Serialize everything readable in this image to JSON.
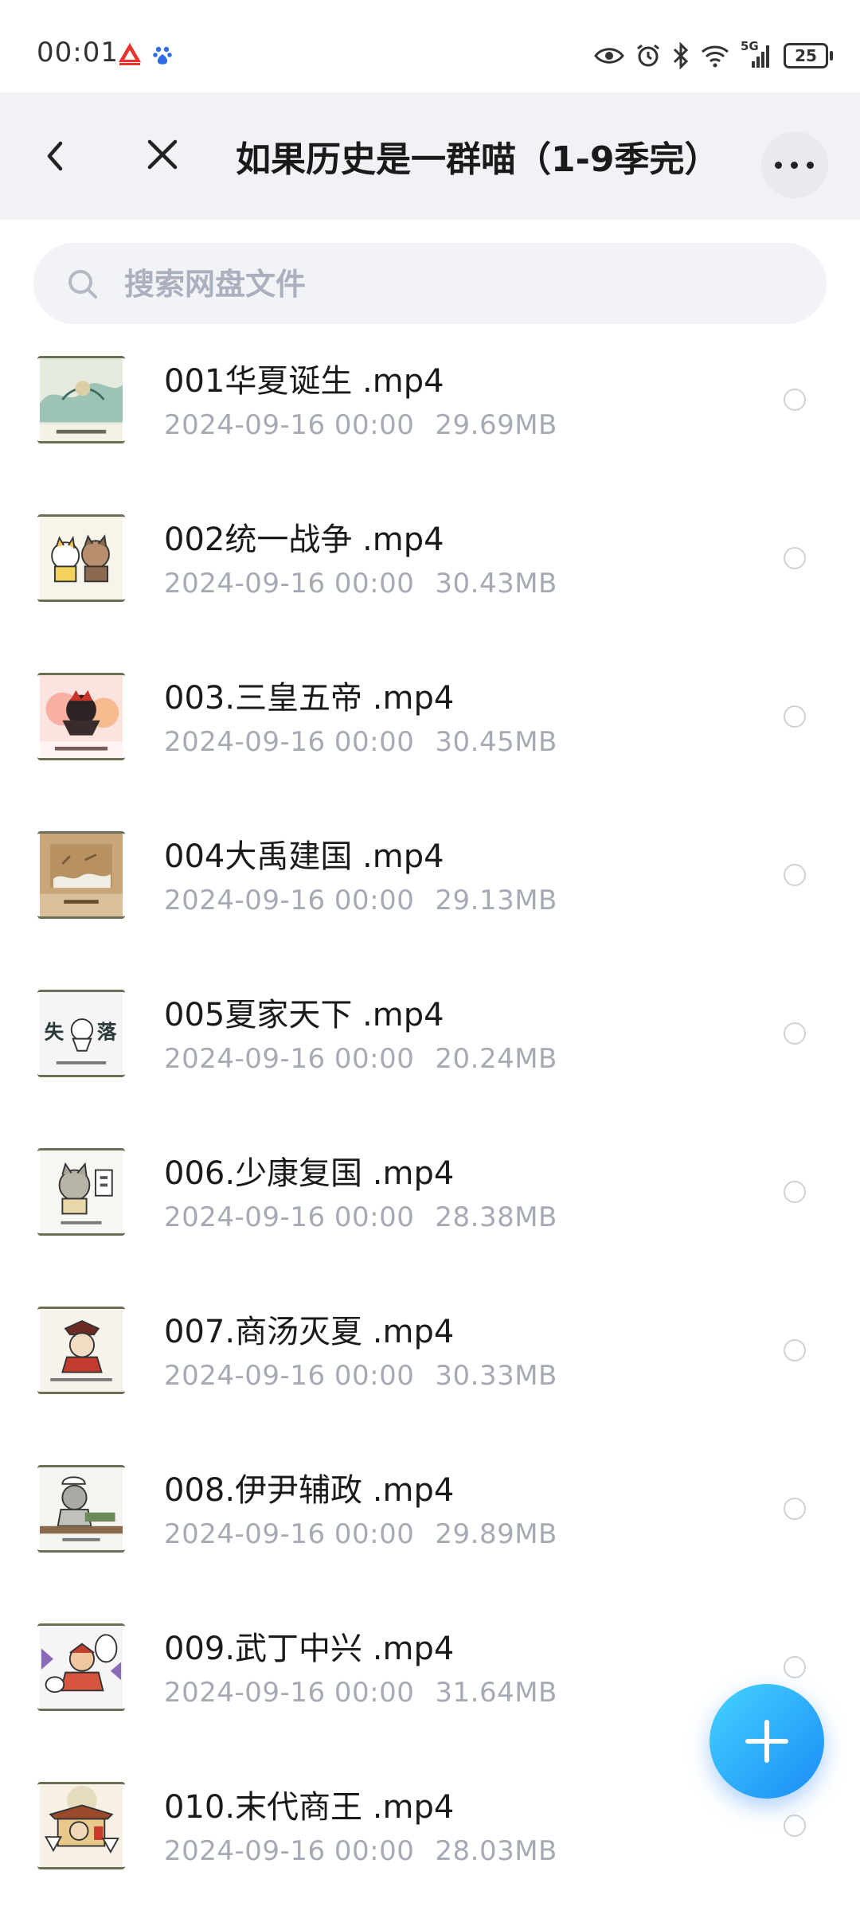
{
  "status_bar": {
    "time": "00:01",
    "network": "5G",
    "battery": "25",
    "icons": [
      "app-icon-red",
      "baidu-icon",
      "eye-icon",
      "alarm-icon",
      "bluetooth-icon",
      "wifi-icon",
      "signal-icon",
      "battery-icon"
    ]
  },
  "header": {
    "title": "如果历史是一群喵（1-9季完）",
    "icons": [
      "back-icon",
      "close-icon",
      "more-icon"
    ]
  },
  "search": {
    "placeholder": "搜索网盘文件"
  },
  "files": [
    {
      "name": "001华夏诞生 .mp4",
      "date": "2024-09-16  00:00",
      "size": "29.69MB",
      "selected": false
    },
    {
      "name": "002统一战争 .mp4",
      "date": "2024-09-16  00:00",
      "size": "30.43MB",
      "selected": false
    },
    {
      "name": "003.三皇五帝 .mp4",
      "date": "2024-09-16  00:00",
      "size": "30.45MB",
      "selected": false
    },
    {
      "name": "004大禹建国 .mp4",
      "date": "2024-09-16  00:00",
      "size": "29.13MB",
      "selected": false
    },
    {
      "name": "005夏家天下 .mp4",
      "date": "2024-09-16  00:00",
      "size": "20.24MB",
      "selected": false
    },
    {
      "name": "006.少康复国 .mp4",
      "date": "2024-09-16  00:00",
      "size": "28.38MB",
      "selected": false
    },
    {
      "name": "007.商汤灭夏 .mp4",
      "date": "2024-09-16  00:00",
      "size": "30.33MB",
      "selected": false
    },
    {
      "name": "008.伊尹辅政 .mp4",
      "date": "2024-09-16  00:00",
      "size": "29.89MB",
      "selected": false
    },
    {
      "name": "009.武丁中兴 .mp4",
      "date": "2024-09-16  00:00",
      "size": "31.64MB",
      "selected": false
    },
    {
      "name": "010.末代商王 .mp4",
      "date": "2024-09-16  00:00",
      "size": "28.03MB",
      "selected": false
    }
  ],
  "thumbnail_text": {
    "file_5": [
      "失",
      "落"
    ]
  },
  "fab": {
    "icon": "plus-icon"
  },
  "colors": {
    "header_bg": "#f1f2f5",
    "search_bg": "#f2f3f7",
    "meta_text": "#a6aab4",
    "fab_start": "#45d2ff",
    "fab_end": "#1a8cf5"
  }
}
